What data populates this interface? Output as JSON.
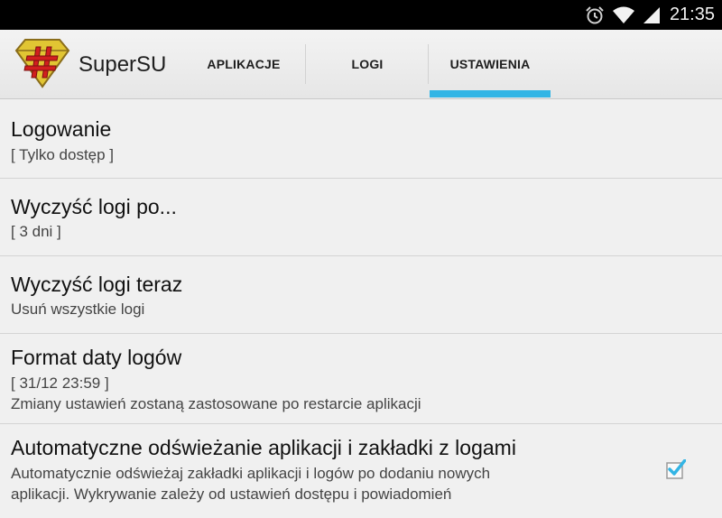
{
  "status_bar": {
    "time": "21:35",
    "icons": [
      "alarm-icon",
      "wifi-icon",
      "signal-icon"
    ]
  },
  "action_bar": {
    "app_title": "SuperSU",
    "logo": "supersu-shield-logo",
    "tabs": [
      {
        "label": "APLIKACJE",
        "selected": false
      },
      {
        "label": "LOGI",
        "selected": false
      },
      {
        "label": "USTAWIENIA",
        "selected": true
      }
    ],
    "accent_color": "#33b5e5"
  },
  "preferences": [
    {
      "title": "Logowanie",
      "summary": "[ Tylko dostęp ]"
    },
    {
      "title": "Wyczyść logi po...",
      "summary": "[ 3 dni ]"
    },
    {
      "title": "Wyczyść logi teraz",
      "summary": "Usuń wszystkie logi"
    },
    {
      "title": "Format daty logów",
      "summary_line1": "[ 31/12 23:59 ]",
      "summary_line2": "Zmiany ustawień zostaną zastosowane po restarcie aplikacji"
    },
    {
      "title": "Automatyczne odświeżanie aplikacji i zakładki z logami",
      "summary_line1": "Automatycznie odświeżaj zakładki aplikacji i logów po dodaniu nowych",
      "summary_line2": "aplikacji. Wykrywanie zależy od ustawień dostępu i powiadomień",
      "checked": true
    }
  ]
}
